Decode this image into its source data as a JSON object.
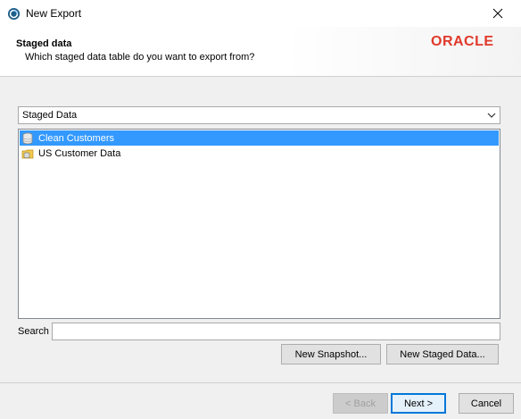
{
  "window": {
    "title": "New Export",
    "close_glyph": "✕"
  },
  "header": {
    "title": "Staged data",
    "subtitle": "Which staged data table do you want to export from?",
    "logo_text": "ORACLE",
    "logo_color": "#e0392b"
  },
  "source_select": {
    "selected": "Staged Data"
  },
  "tables": [
    {
      "label": "Clean Customers",
      "icon": "database-icon",
      "selected": true
    },
    {
      "label": "US Customer Data",
      "icon": "data-folder-icon",
      "selected": false
    }
  ],
  "search": {
    "label": "Search",
    "value": ""
  },
  "actions": {
    "new_snapshot": "New Snapshot...",
    "new_staged_data": "New Staged Data..."
  },
  "nav": {
    "back": "< Back",
    "next": "Next >",
    "cancel": "Cancel"
  },
  "colors": {
    "selection": "#3399ff",
    "default_button_border": "#0078d7"
  }
}
